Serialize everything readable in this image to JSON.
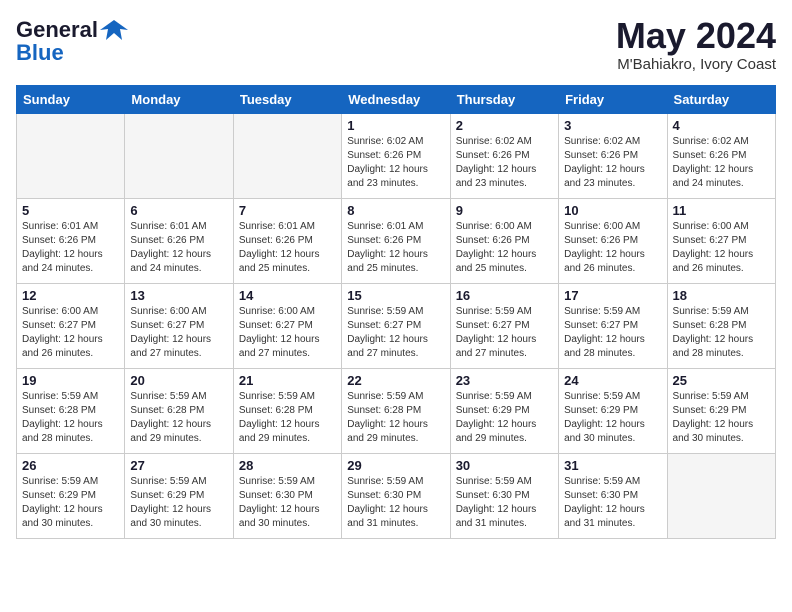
{
  "logo": {
    "line1": "General",
    "line2": "Blue"
  },
  "title": {
    "month_year": "May 2024",
    "location": "M'Bahiakro, Ivory Coast"
  },
  "weekdays": [
    "Sunday",
    "Monday",
    "Tuesday",
    "Wednesday",
    "Thursday",
    "Friday",
    "Saturday"
  ],
  "weeks": [
    [
      {
        "day": "",
        "info": ""
      },
      {
        "day": "",
        "info": ""
      },
      {
        "day": "",
        "info": ""
      },
      {
        "day": "1",
        "info": "Sunrise: 6:02 AM\nSunset: 6:26 PM\nDaylight: 12 hours\nand 23 minutes."
      },
      {
        "day": "2",
        "info": "Sunrise: 6:02 AM\nSunset: 6:26 PM\nDaylight: 12 hours\nand 23 minutes."
      },
      {
        "day": "3",
        "info": "Sunrise: 6:02 AM\nSunset: 6:26 PM\nDaylight: 12 hours\nand 23 minutes."
      },
      {
        "day": "4",
        "info": "Sunrise: 6:02 AM\nSunset: 6:26 PM\nDaylight: 12 hours\nand 24 minutes."
      }
    ],
    [
      {
        "day": "5",
        "info": "Sunrise: 6:01 AM\nSunset: 6:26 PM\nDaylight: 12 hours\nand 24 minutes."
      },
      {
        "day": "6",
        "info": "Sunrise: 6:01 AM\nSunset: 6:26 PM\nDaylight: 12 hours\nand 24 minutes."
      },
      {
        "day": "7",
        "info": "Sunrise: 6:01 AM\nSunset: 6:26 PM\nDaylight: 12 hours\nand 25 minutes."
      },
      {
        "day": "8",
        "info": "Sunrise: 6:01 AM\nSunset: 6:26 PM\nDaylight: 12 hours\nand 25 minutes."
      },
      {
        "day": "9",
        "info": "Sunrise: 6:00 AM\nSunset: 6:26 PM\nDaylight: 12 hours\nand 25 minutes."
      },
      {
        "day": "10",
        "info": "Sunrise: 6:00 AM\nSunset: 6:26 PM\nDaylight: 12 hours\nand 26 minutes."
      },
      {
        "day": "11",
        "info": "Sunrise: 6:00 AM\nSunset: 6:27 PM\nDaylight: 12 hours\nand 26 minutes."
      }
    ],
    [
      {
        "day": "12",
        "info": "Sunrise: 6:00 AM\nSunset: 6:27 PM\nDaylight: 12 hours\nand 26 minutes."
      },
      {
        "day": "13",
        "info": "Sunrise: 6:00 AM\nSunset: 6:27 PM\nDaylight: 12 hours\nand 27 minutes."
      },
      {
        "day": "14",
        "info": "Sunrise: 6:00 AM\nSunset: 6:27 PM\nDaylight: 12 hours\nand 27 minutes."
      },
      {
        "day": "15",
        "info": "Sunrise: 5:59 AM\nSunset: 6:27 PM\nDaylight: 12 hours\nand 27 minutes."
      },
      {
        "day": "16",
        "info": "Sunrise: 5:59 AM\nSunset: 6:27 PM\nDaylight: 12 hours\nand 27 minutes."
      },
      {
        "day": "17",
        "info": "Sunrise: 5:59 AM\nSunset: 6:27 PM\nDaylight: 12 hours\nand 28 minutes."
      },
      {
        "day": "18",
        "info": "Sunrise: 5:59 AM\nSunset: 6:28 PM\nDaylight: 12 hours\nand 28 minutes."
      }
    ],
    [
      {
        "day": "19",
        "info": "Sunrise: 5:59 AM\nSunset: 6:28 PM\nDaylight: 12 hours\nand 28 minutes."
      },
      {
        "day": "20",
        "info": "Sunrise: 5:59 AM\nSunset: 6:28 PM\nDaylight: 12 hours\nand 29 minutes."
      },
      {
        "day": "21",
        "info": "Sunrise: 5:59 AM\nSunset: 6:28 PM\nDaylight: 12 hours\nand 29 minutes."
      },
      {
        "day": "22",
        "info": "Sunrise: 5:59 AM\nSunset: 6:28 PM\nDaylight: 12 hours\nand 29 minutes."
      },
      {
        "day": "23",
        "info": "Sunrise: 5:59 AM\nSunset: 6:29 PM\nDaylight: 12 hours\nand 29 minutes."
      },
      {
        "day": "24",
        "info": "Sunrise: 5:59 AM\nSunset: 6:29 PM\nDaylight: 12 hours\nand 30 minutes."
      },
      {
        "day": "25",
        "info": "Sunrise: 5:59 AM\nSunset: 6:29 PM\nDaylight: 12 hours\nand 30 minutes."
      }
    ],
    [
      {
        "day": "26",
        "info": "Sunrise: 5:59 AM\nSunset: 6:29 PM\nDaylight: 12 hours\nand 30 minutes."
      },
      {
        "day": "27",
        "info": "Sunrise: 5:59 AM\nSunset: 6:29 PM\nDaylight: 12 hours\nand 30 minutes."
      },
      {
        "day": "28",
        "info": "Sunrise: 5:59 AM\nSunset: 6:30 PM\nDaylight: 12 hours\nand 30 minutes."
      },
      {
        "day": "29",
        "info": "Sunrise: 5:59 AM\nSunset: 6:30 PM\nDaylight: 12 hours\nand 31 minutes."
      },
      {
        "day": "30",
        "info": "Sunrise: 5:59 AM\nSunset: 6:30 PM\nDaylight: 12 hours\nand 31 minutes."
      },
      {
        "day": "31",
        "info": "Sunrise: 5:59 AM\nSunset: 6:30 PM\nDaylight: 12 hours\nand 31 minutes."
      },
      {
        "day": "",
        "info": ""
      }
    ]
  ]
}
